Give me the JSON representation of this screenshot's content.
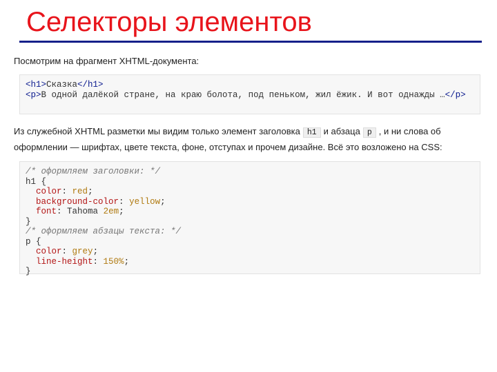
{
  "slide": {
    "title": "Селекторы элементов"
  },
  "intro": {
    "text": "Посмотрим на фрагмент XHTML-документа:"
  },
  "html_code": {
    "h1_open": "<h1>",
    "h1_text": "Сказка",
    "h1_close": "</h1>",
    "p_open": "<p>",
    "p_text": "В одной далёкой стране, на краю болота, под пеньком, жил ёжик. И вот однажды …",
    "p_close": "</p>"
  },
  "explanation": {
    "part1": "Из служебной XHTML разметки мы видим только элемент заголовка",
    "code1": "h1",
    "part2": "и абзаца",
    "code2": "p",
    "part3": ", и ни слова об оформлении — шрифтах, цвете текста, фоне, отступах и прочем дизайне. Всё это возложено на CSS:"
  },
  "css_code": {
    "comment1": "/* оформляем заголовки: */",
    "sel1": "h1",
    "open1": " {",
    "r1_prop": "color",
    "r1_val": "red",
    "r2_prop": "background-color",
    "r2_val": "yellow",
    "r3_prop": "font",
    "r3_val_a": "Tahoma",
    "r3_val_b": "2em",
    "close1": "}",
    "comment2": "/* оформляем абзацы текста: */",
    "sel2": "p",
    "open2": " {",
    "r4_prop": "color",
    "r4_val": "grey",
    "r5_prop": "line-height",
    "r5_val": "150%",
    "close2": "}"
  }
}
